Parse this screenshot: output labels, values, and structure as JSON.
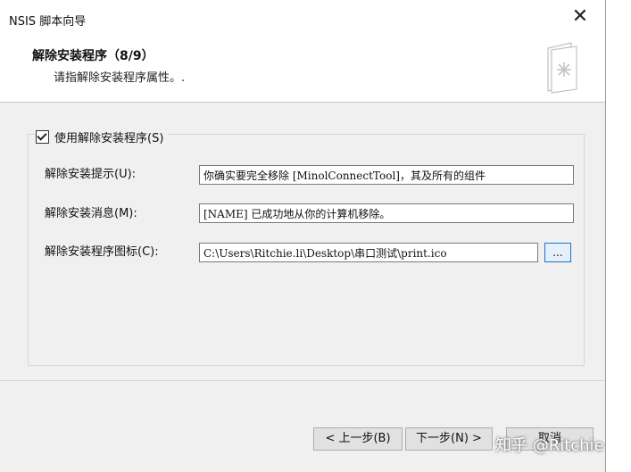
{
  "window": {
    "title": "NSIS 脚本向导"
  },
  "header": {
    "title": "解除安装程序（8/9）",
    "subtitle": "请指解除安装程序属性。."
  },
  "uninstaller": {
    "checkbox_label": "使用解除安装程序(S)",
    "checked": true,
    "prompt_label": "解除安装提示(U):",
    "prompt_value": "你确实要完全移除 [MinolConnectTool]，其及所有的组件",
    "message_label": "解除安装消息(M):",
    "message_value": "[NAME] 已成功地从你的计算机移除。",
    "icon_label": "解除安装程序图标(C):",
    "icon_value": "C:\\Users\\Ritchie.li\\Desktop\\串口测试\\print.ico",
    "browse_label": "..."
  },
  "footer": {
    "back_label": "< 上一步(B)",
    "next_label": "下一步(N) >",
    "cancel_label": "取消"
  },
  "watermark": "知乎 @Ritchie",
  "colors": {
    "accent": "#1a73d0",
    "background": "#f0f0f0"
  }
}
